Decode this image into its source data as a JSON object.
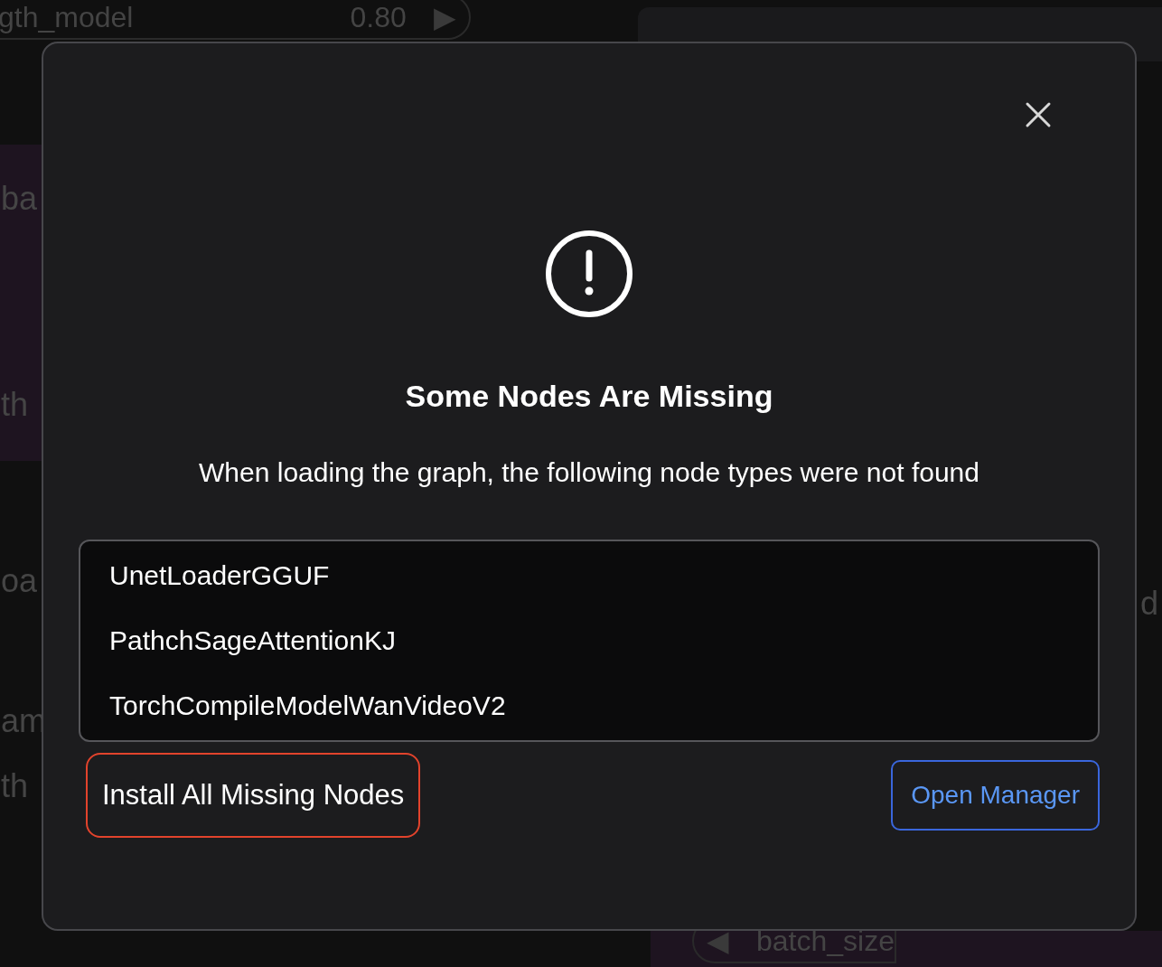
{
  "canvas": {
    "widgets": [
      {
        "kind": "pill",
        "label": "gth_model",
        "value": "0.80",
        "arrow": "▶"
      },
      {
        "kind": "pill",
        "label": "batch_size",
        "arrow": "◀"
      }
    ],
    "fragments": [
      "ba",
      "th",
      "oa",
      "am",
      "th",
      "d"
    ]
  },
  "dialog": {
    "title": "Some Nodes Are Missing",
    "message": "When loading the graph, the following node types were not found",
    "missing_nodes": [
      "UnetLoaderGGUF",
      "PathchSageAttentionKJ",
      "TorchCompileModelWanVideoV2"
    ],
    "buttons": [
      {
        "label": "Install All Missing Nodes",
        "kind": "install"
      },
      {
        "label": "Open Manager",
        "kind": "manager"
      }
    ]
  }
}
